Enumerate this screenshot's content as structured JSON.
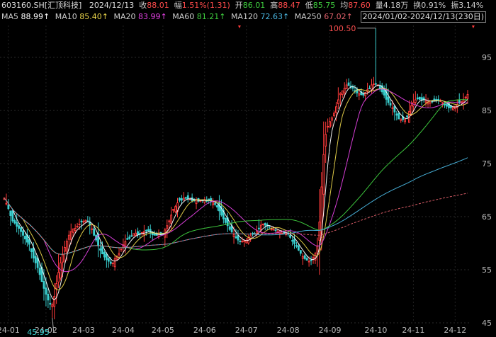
{
  "header": {
    "code": "603160.SH[汇顶科技]",
    "date": "2024/12/13",
    "close_label": "收",
    "close_value": "88.01",
    "change_label": "幅",
    "change_value": "1.51%(1.31)",
    "open_label": "开",
    "open_value": "86.01",
    "high_label": "高",
    "high_value": "88.47",
    "low_label": "低",
    "low_value": "85.75",
    "avg_label": "均",
    "avg_value": "87.60",
    "vol_label": "量",
    "vol_value": "4.18万",
    "turnover_label": "换",
    "turnover_value": "0.91%",
    "amp_label": "振",
    "amp_value": "3.14%",
    "range": "2024/01/02-2024/12/13(230日)"
  },
  "ma_legend": [
    {
      "label": "MA5",
      "value": "88.99↑",
      "color": "#ffffff"
    },
    {
      "label": "MA10",
      "value": "85.40↑",
      "color": "#e8d34a"
    },
    {
      "label": "MA20",
      "value": "83.99↑",
      "color": "#e040e0"
    },
    {
      "label": "MA60",
      "value": "81.21↑",
      "color": "#3fcf3f"
    },
    {
      "label": "MA120",
      "value": "72.63↑",
      "color": "#4ab6e0"
    },
    {
      "label": "MA250",
      "value": "67.02↑",
      "color": "#e0606a"
    }
  ],
  "colors": {
    "up": "#ff3b3b",
    "down": "#3bd1d1",
    "text": "#cccccc",
    "grid": "#2a2a2a"
  },
  "chart_data": {
    "type": "candlestick",
    "ylim": [
      45,
      101
    ],
    "yticks": [
      95,
      85,
      75,
      65,
      55,
      45
    ],
    "xticks": [
      "24-01",
      "24-02",
      "24-03",
      "24-04",
      "24-05",
      "24-06",
      "24-07",
      "24-08",
      "24-09",
      "24-10",
      "24-11",
      "24-12"
    ],
    "xtick_index": [
      2,
      20,
      38,
      57,
      76,
      96,
      116,
      136,
      156,
      178,
      196,
      216
    ],
    "high_annotation": {
      "value": "100.50",
      "index": 178
    },
    "low_annotation": {
      "value": "45.95",
      "index": 23
    },
    "close": [
      68.5,
      67.5,
      66.5,
      65.2,
      64.2,
      63.8,
      63.2,
      62.8,
      62.2,
      61.5,
      60.8,
      60.2,
      59.8,
      58.4,
      57.2,
      56.3,
      55.4,
      54.1,
      52.8,
      51.5,
      50.4,
      49.3,
      48.5,
      48.4,
      50.0,
      52.4,
      54.5,
      56.3,
      57.8,
      59.2,
      60.4,
      61.5,
      62.2,
      62.7,
      62.8,
      63.2,
      63.6,
      64.0,
      64.1,
      64.3,
      64.2,
      63.4,
      62.7,
      61.5,
      60.6,
      59.5,
      58.7,
      58.0,
      57.4,
      56.9,
      56.6,
      56.2,
      56.3,
      57.1,
      57.5,
      58.1,
      58.9,
      59.7,
      60.3,
      60.7,
      60.9,
      61.4,
      61.8,
      61.9,
      61.6,
      61.8,
      62.0,
      62.2,
      62.3,
      62.4,
      61.9,
      61.6,
      61.5,
      61.5,
      61.7,
      61.7,
      61.8,
      62.5,
      63.3,
      64.2,
      65.3,
      66.4,
      66.9,
      67.6,
      68.1,
      68.1,
      68.5,
      68.5,
      68.4,
      68.3,
      68.0,
      68.0,
      68.2,
      67.9,
      68.0,
      68.1,
      68.2,
      67.9,
      68.0,
      67.8,
      67.6,
      67.3,
      66.8,
      66.1,
      65.3,
      64.6,
      63.9,
      63.3,
      62.6,
      62.1,
      61.6,
      61.0,
      60.6,
      60.4,
      60.4,
      60.5,
      60.5,
      61.0,
      61.4,
      61.7,
      61.8,
      62.3,
      62.8,
      63.4,
      63.6,
      63.4,
      63.3,
      63.0,
      62.7,
      62.6,
      62.4,
      62.3,
      62.1,
      61.9,
      61.8,
      61.9,
      61.7,
      61.1,
      60.4,
      59.9,
      59.4,
      58.7,
      58.1,
      57.5,
      57.1,
      56.8,
      56.6,
      56.8,
      57.3,
      58.0,
      59.5,
      64.0,
      70.6,
      76.7,
      80.5,
      82.0,
      82.9,
      83.6,
      84.5,
      85.7,
      87.0,
      88.2,
      88.7,
      89.2,
      89.8,
      89.7,
      89.6,
      89.2,
      88.6,
      88.3,
      88.2,
      88.0,
      87.9,
      88.4,
      88.9,
      89.2,
      89.8,
      90.0,
      90.0,
      89.8,
      89.1,
      88.5,
      87.9,
      87.1,
      86.5,
      86.0,
      85.5,
      84.7,
      84.1,
      83.4,
      83.4,
      83.3,
      83.3,
      83.9,
      84.8,
      85.9,
      86.5,
      87.0,
      87.2,
      87.1,
      86.9,
      87.0,
      86.8,
      86.6,
      86.8,
      86.6,
      86.9,
      87.0,
      86.9,
      86.8,
      86.5,
      86.1,
      85.8,
      85.5,
      85.5,
      85.6,
      85.8,
      86.1,
      86.4,
      86.7,
      87.0,
      87.5,
      88.0
    ]
  }
}
